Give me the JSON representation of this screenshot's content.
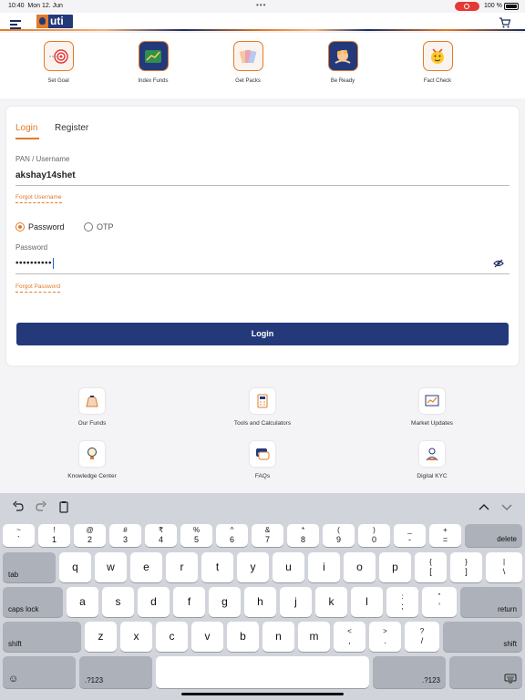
{
  "status_bar": {
    "time": "10:40",
    "date": "Mon 12. Jun",
    "multitask": "•••",
    "battery": "100 %"
  },
  "header": {
    "logo_text": "uti"
  },
  "tiles": [
    {
      "label": "Set Goal",
      "icon": "target-icon"
    },
    {
      "label": "Index Funds",
      "icon": "chart-icon"
    },
    {
      "label": "Get Packs",
      "icon": "packs-icon"
    },
    {
      "label": "Be Ready",
      "icon": "plant-hand-icon"
    },
    {
      "label": "Fact Check",
      "icon": "emoji-icon"
    }
  ],
  "login": {
    "tabs": [
      "Login",
      "Register"
    ],
    "active_tab": "Login",
    "username_label": "PAN / Username",
    "username_value": "akshay14shet",
    "forgot_username": "Forgot Username",
    "radio_password": "Password",
    "radio_otp": "OTP",
    "selected_mode": "Password",
    "password_label": "Password",
    "password_value": "••••••••••",
    "forgot_password": "Forgot Password",
    "submit_label": "Login"
  },
  "services": [
    {
      "label": "Our Funds",
      "icon": "money-bag-icon"
    },
    {
      "label": "Tools and Calculators",
      "icon": "calculator-icon"
    },
    {
      "label": "Market Updates",
      "icon": "market-chart-icon"
    },
    {
      "label": "Knowledge Center",
      "icon": "lightbulb-icon"
    },
    {
      "label": "FAQs",
      "icon": "faq-icon"
    },
    {
      "label": "Digital KYC",
      "icon": "kyc-icon"
    }
  ],
  "keyboard": {
    "row1": [
      {
        "top": "~",
        "bottom": "`"
      },
      {
        "top": "!",
        "bottom": "1"
      },
      {
        "top": "@",
        "bottom": "2"
      },
      {
        "top": "#",
        "bottom": "3"
      },
      {
        "top": "₹",
        "bottom": "4"
      },
      {
        "top": "%",
        "bottom": "5"
      },
      {
        "top": "^",
        "bottom": "6"
      },
      {
        "top": "&",
        "bottom": "7"
      },
      {
        "top": "*",
        "bottom": "8"
      },
      {
        "top": "(",
        "bottom": "9"
      },
      {
        "top": ")",
        "bottom": "0"
      },
      {
        "top": "_",
        "bottom": "-"
      },
      {
        "top": "+",
        "bottom": "="
      }
    ],
    "delete": "delete",
    "tab": "tab",
    "row2": [
      "q",
      "w",
      "e",
      "r",
      "t",
      "y",
      "u",
      "i",
      "o",
      "p"
    ],
    "row2_extra": [
      {
        "top": "{",
        "bottom": "["
      },
      {
        "top": "}",
        "bottom": "]"
      },
      {
        "top": "|",
        "bottom": "\\"
      }
    ],
    "caps": "caps lock",
    "row3": [
      "a",
      "s",
      "d",
      "f",
      "g",
      "h",
      "j",
      "k",
      "l"
    ],
    "row3_extra": [
      {
        "top": ":",
        "bottom": ";"
      },
      {
        "top": "”",
        "bottom": "’"
      }
    ],
    "return": "return",
    "shift": "shift",
    "row4": [
      "z",
      "x",
      "c",
      "v",
      "b",
      "n",
      "m"
    ],
    "row4_extra": [
      {
        "top": "<",
        "bottom": ","
      },
      {
        "top": ">",
        "bottom": "."
      },
      {
        "top": "?",
        "bottom": "/"
      }
    ],
    "numbers_left": ".?123",
    "numbers_right": ".?123",
    "emoji": "☺"
  }
}
